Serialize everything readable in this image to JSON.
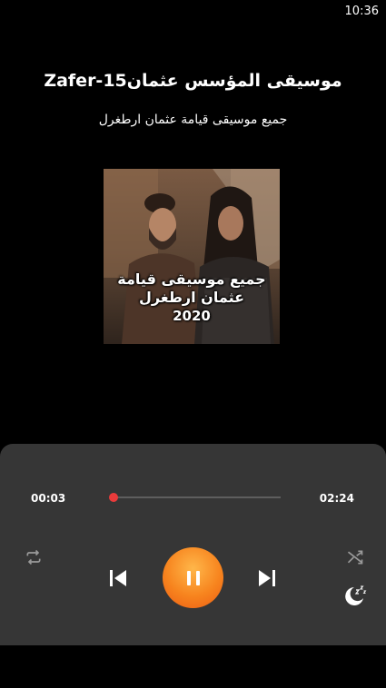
{
  "status_bar": {
    "time": "10:36"
  },
  "track": {
    "title": "موسيقى المؤسس عثمانZafer-15",
    "album": "جميع موسيقى قيامة عثمان ارطغرل"
  },
  "cover": {
    "caption": "جميع موسيقى قيامة عثمان ارطغرل",
    "year": "2020"
  },
  "player": {
    "elapsed": "00:03",
    "total": "02:24",
    "progress_fraction": 0.02,
    "accent_color": "#ea3b3b",
    "play_button_color": "#f7841e",
    "icons": {
      "repeat": "repeat-icon",
      "previous": "skip-previous-icon",
      "play_state": "pause-icon",
      "next": "skip-next-icon",
      "shuffle": "shuffle-icon",
      "sleep": "sleep-timer-icon"
    }
  }
}
